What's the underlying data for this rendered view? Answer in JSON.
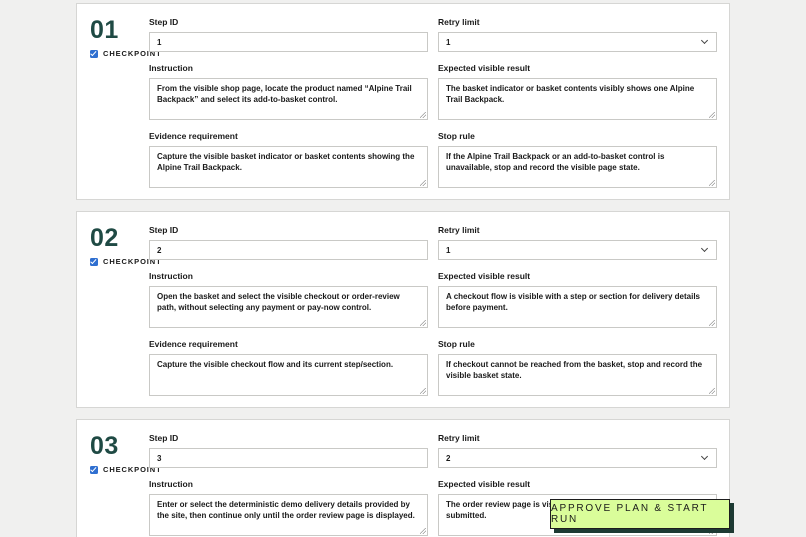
{
  "labels": {
    "step_id": "Step ID",
    "retry_limit": "Retry limit",
    "instruction": "Instruction",
    "expected_result": "Expected visible result",
    "evidence": "Evidence requirement",
    "stop_rule": "Stop rule",
    "checkpoint": "CHECKPOINT"
  },
  "steps": [
    {
      "number": "01",
      "step_id": "1",
      "retry_limit": "1",
      "checkpoint": true,
      "instruction": "From the visible shop page, locate the product named “Alpine Trail Backpack” and select its add-to-basket control.",
      "expected_result": "The basket indicator or basket contents visibly shows one Alpine Trail Backpack.",
      "evidence": "Capture the visible basket indicator or basket contents showing the Alpine Trail Backpack.",
      "stop_rule": "If the Alpine Trail Backpack or an add-to-basket control is unavailable, stop and record the visible page state."
    },
    {
      "number": "02",
      "step_id": "2",
      "retry_limit": "1",
      "checkpoint": true,
      "instruction": "Open the basket and select the visible checkout or order-review path, without selecting any payment or pay-now control.",
      "expected_result": "A checkout flow is visible with a step or section for delivery details before payment.",
      "evidence": "Capture the visible checkout flow and its current step/section.",
      "stop_rule": "If checkout cannot be reached from the basket, stop and record the visible basket state."
    },
    {
      "number": "03",
      "step_id": "3",
      "retry_limit": "2",
      "checkpoint": true,
      "instruction": "Enter or select the deterministic demo delivery details provided by the site, then continue only until the order review page is displayed.",
      "expected_result": "The order review page is visible and no order confirmation has been submitted."
    }
  ],
  "approve_button": "APPROVE PLAN & START RUN"
}
